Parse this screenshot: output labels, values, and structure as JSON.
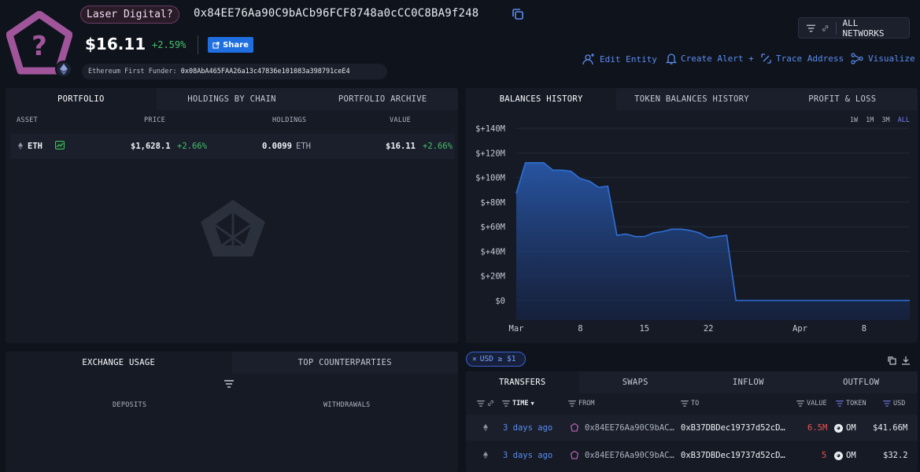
{
  "header": {
    "entity_name": "Laser Digital?",
    "address": "0x84EE76Aa90C9bACb96FCF8748a0cCC0C8BA9f248",
    "balance": "$16.11",
    "balance_change": "+2.59%",
    "share_label": "Share",
    "first_funder_label": "Ethereum First Funder:",
    "first_funder_address": "0x08AbA465FAA26a13c47836e101083a398791ceE4",
    "networks_label": "ALL NETWORKS"
  },
  "actions": {
    "edit_entity": "Edit Entity",
    "create_alert": "Create Alert +",
    "trace_address": "Trace Address",
    "visualize": "Visualize"
  },
  "portfolio": {
    "tabs": [
      "PORTFOLIO",
      "HOLDINGS BY CHAIN",
      "PORTFOLIO ARCHIVE"
    ],
    "columns": [
      "ASSET",
      "PRICE",
      "HOLDINGS",
      "VALUE"
    ],
    "rows": [
      {
        "asset": "ETH",
        "price": "$1,628.1",
        "price_change": "+2.66%",
        "holdings": "0.0099",
        "holdings_unit": "ETH",
        "value": "$16.11",
        "value_change": "+2.66%"
      }
    ]
  },
  "balances": {
    "tabs": [
      "BALANCES HISTORY",
      "TOKEN BALANCES HISTORY",
      "PROFIT & LOSS"
    ],
    "ranges": [
      "1W",
      "1M",
      "3M",
      "ALL"
    ],
    "active_range": "ALL"
  },
  "chart_data": {
    "type": "area",
    "title": "",
    "xlabel": "",
    "ylabel": "",
    "y_tick_labels": [
      "$0",
      "$+20M",
      "$+40M",
      "$+60M",
      "$+80M",
      "$+100M",
      "$+120M",
      "$+140M"
    ],
    "y_ticks": [
      0,
      20,
      40,
      60,
      80,
      100,
      120,
      140
    ],
    "ylim": [
      -16,
      142
    ],
    "y_unit": "$M",
    "x_tick_labels": [
      "Mar",
      "8",
      "15",
      "22",
      "Apr",
      "8"
    ],
    "x_ticks": [
      "Mar 1",
      "Mar 8",
      "Mar 15",
      "Mar 22",
      "Apr 1",
      "Apr 8"
    ],
    "x": [
      "Mar 1",
      "Mar 2",
      "Mar 3",
      "Mar 4",
      "Mar 5",
      "Mar 6",
      "Mar 7",
      "Mar 8",
      "Mar 9",
      "Mar 10",
      "Mar 11",
      "Mar 12",
      "Mar 13",
      "Mar 14",
      "Mar 15",
      "Mar 16",
      "Mar 17",
      "Mar 18",
      "Mar 19",
      "Mar 20",
      "Mar 21",
      "Mar 22",
      "Mar 23",
      "Mar 24",
      "Mar 25",
      "Mar 31",
      "Apr 6",
      "Apr 13"
    ],
    "series": [
      {
        "values": [
          87,
          112,
          112,
          112,
          106,
          106,
          105,
          99,
          97,
          92,
          93,
          53,
          54,
          52,
          52,
          55,
          56,
          58,
          58,
          57,
          55,
          51,
          52,
          53,
          0,
          0,
          0,
          0
        ]
      }
    ],
    "grid": true,
    "color": "#2f6fd6"
  },
  "exchange": {
    "tabs": [
      "EXCHANGE USAGE",
      "TOP COUNTERPARTIES"
    ],
    "columns": [
      "DEPOSITS",
      "WITHDRAWALS"
    ]
  },
  "transfers": {
    "filter_label": "USD ≥ $1",
    "tabs": [
      "TRANSFERS",
      "SWAPS",
      "INFLOW",
      "OUTFLOW"
    ],
    "columns": {
      "time": "TIME",
      "from": "FROM",
      "to": "TO",
      "value": "VALUE",
      "token": "TOKEN",
      "usd": "USD"
    },
    "rows": [
      {
        "time": "3 days ago",
        "from": "0x84EE76Aa90C9bAC…",
        "to": "0xB37DBDec19737d52cD…",
        "value": "6.5M",
        "token": "OM",
        "usd": "$41.66M"
      },
      {
        "time": "3 days ago",
        "from": "0x84EE76Aa90C9bAC…",
        "to": "0xB37DBDec19737d52cD…",
        "value": "5",
        "token": "OM",
        "usd": "$32.2"
      }
    ]
  }
}
